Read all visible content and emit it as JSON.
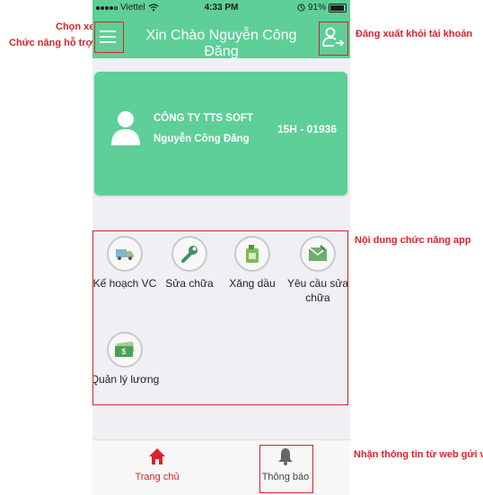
{
  "status_bar": {
    "carrier": "Viettel",
    "time": "4:33 PM",
    "battery": "91%"
  },
  "header": {
    "title": "Xin Chào Nguyễn Công Đăng",
    "menu_icon": "hamburger-menu-icon",
    "logout_icon": "logout-user-icon"
  },
  "card": {
    "company": "CÔNG TY TTS SOFT",
    "name": "Nguyễn Công Đăng",
    "plate": "15H - 01936"
  },
  "functions": [
    {
      "label": "Kế hoạch VC",
      "icon": "truck-icon"
    },
    {
      "label": "Sửa chữa",
      "icon": "wrench-icon"
    },
    {
      "label": "Xăng dầu",
      "icon": "fuel-can-icon"
    },
    {
      "label": "Yêu cầu sửa chữa",
      "icon": "repair-request-icon"
    },
    {
      "label": "Quản lý lương",
      "icon": "money-icon"
    }
  ],
  "tabs": [
    {
      "label": "Trang chủ",
      "icon": "home-icon",
      "color": "#d9232a"
    },
    {
      "label": "Thông báo",
      "icon": "bell-icon",
      "color": "#444444"
    }
  ],
  "annotations": {
    "chon_xe": "Chọn xe",
    "chuc_nang_ho_tro": "Chức năng hỗ trợ",
    "dang_xuat": "Đăng xuất khỏi tài khoản",
    "noi_dung": "Nội dung chức năng app",
    "nhan_thong_tin": "Nhận thông tin từ web gửi về"
  },
  "colors": {
    "primary": "#5dcf97",
    "annotation": "#d9232a"
  }
}
